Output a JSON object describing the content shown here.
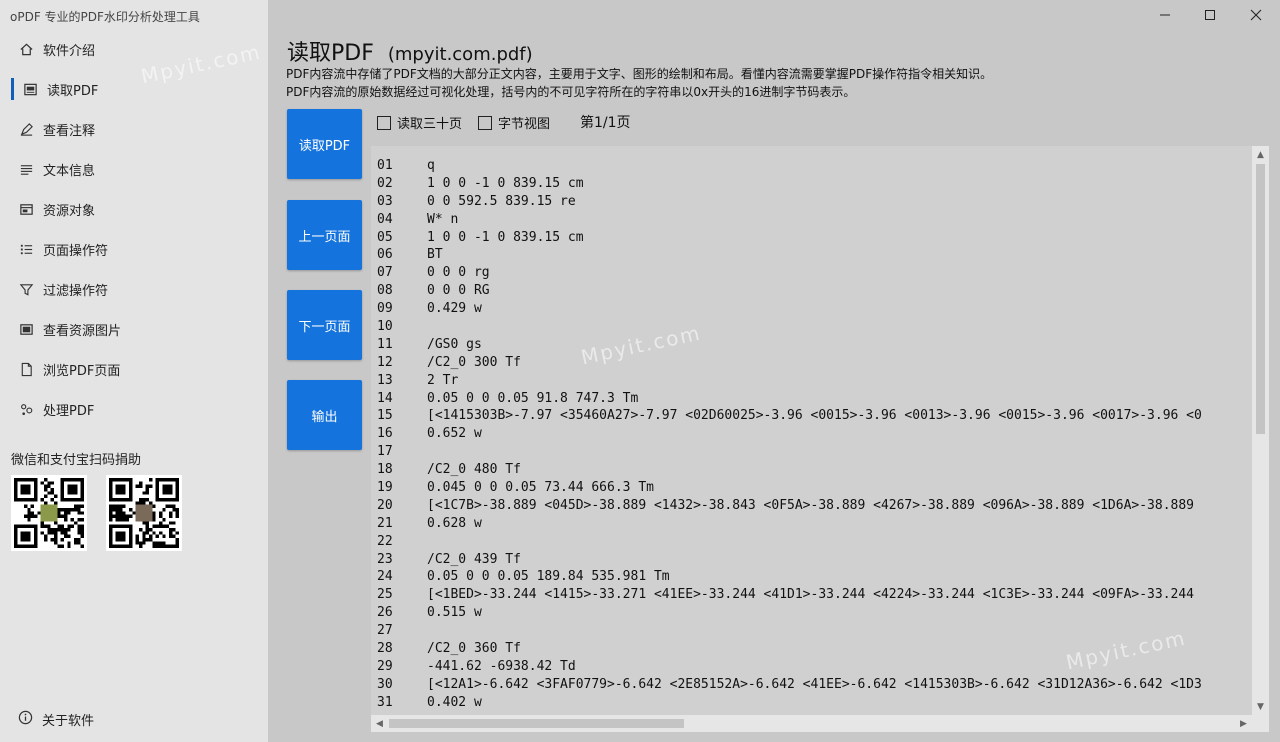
{
  "app": {
    "title": "oPDF 专业的PDF水印分析处理工具"
  },
  "sidebar": {
    "items": [
      {
        "label": "软件介绍",
        "icon": "home-icon"
      },
      {
        "label": "读取PDF",
        "icon": "pdf-icon",
        "active": true
      },
      {
        "label": "查看注释",
        "icon": "annotation-icon"
      },
      {
        "label": "文本信息",
        "icon": "text-lines-icon"
      },
      {
        "label": "资源对象",
        "icon": "resource-icon"
      },
      {
        "label": "页面操作符",
        "icon": "list-icon"
      },
      {
        "label": "过滤操作符",
        "icon": "filter-icon"
      },
      {
        "label": "查看资源图片",
        "icon": "image-icon"
      },
      {
        "label": "浏览PDF页面",
        "icon": "page-icon"
      },
      {
        "label": "处理PDF",
        "icon": "process-icon"
      }
    ],
    "donate_label": "微信和支付宝扫码捐助",
    "about_label": "关于软件"
  },
  "main": {
    "title": "读取PDF",
    "filename": "(mpyit.com.pdf)",
    "desc1": "PDF内容流中存储了PDF文档的大部分正文内容，主要用于文字、图形的绘制和布局。看懂内容流需要掌握PDF操作符指令相关知识。",
    "desc2": "PDF内容流的原始数据经过可视化处理，括号内的不可见字符所在的字符串以0x开头的16进制字节码表示。",
    "buttons": {
      "read": "读取PDF",
      "prev": "上一页面",
      "next": "下一页面",
      "export": "输出"
    },
    "options": {
      "read30": "读取三十页",
      "byteview": "字节视图"
    },
    "page_info": "第1/1页",
    "watermark": "Mpyit.com",
    "lines": [
      {
        "n": "01",
        "t": "q"
      },
      {
        "n": "02",
        "t": "1 0 0 -1 0 839.15 cm"
      },
      {
        "n": "03",
        "t": "0 0 592.5 839.15 re"
      },
      {
        "n": "04",
        "t": "W* n"
      },
      {
        "n": "05",
        "t": "1 0 0 -1 0 839.15 cm"
      },
      {
        "n": "06",
        "t": "BT"
      },
      {
        "n": "07",
        "t": "0 0 0 rg"
      },
      {
        "n": "08",
        "t": "0 0 0 RG"
      },
      {
        "n": "09",
        "t": "0.429 w"
      },
      {
        "n": "10",
        "t": ""
      },
      {
        "n": "11",
        "t": "/GS0 gs"
      },
      {
        "n": "12",
        "t": "/C2_0 300 Tf"
      },
      {
        "n": "13",
        "t": "2 Tr"
      },
      {
        "n": "14",
        "t": "0.05 0 0 0.05 91.8 747.3 Tm"
      },
      {
        "n": "15",
        "t": "[<1415303B>-7.97 <35460A27>-7.97 <02D60025>-3.96 <0015>-3.96 <0013>-3.96 <0015>-3.96 <0017>-3.96 <0"
      },
      {
        "n": "16",
        "t": "0.652 w"
      },
      {
        "n": "17",
        "t": ""
      },
      {
        "n": "18",
        "t": "/C2_0 480 Tf"
      },
      {
        "n": "19",
        "t": "0.045 0 0 0.05 73.44 666.3 Tm"
      },
      {
        "n": "20",
        "t": "[<1C7B>-38.889 <045D>-38.889 <1432>-38.843 <0F5A>-38.889 <4267>-38.889 <096A>-38.889 <1D6A>-38.889"
      },
      {
        "n": "21",
        "t": "0.628 w"
      },
      {
        "n": "22",
        "t": ""
      },
      {
        "n": "23",
        "t": "/C2_0 439 Tf"
      },
      {
        "n": "24",
        "t": "0.05 0 0 0.05 189.84 535.981 Tm"
      },
      {
        "n": "25",
        "t": "[<1BED>-33.244 <1415>-33.271 <41EE>-33.244 <41D1>-33.244 <4224>-33.244 <1C3E>-33.244 <09FA>-33.244"
      },
      {
        "n": "26",
        "t": "0.515 w"
      },
      {
        "n": "27",
        "t": ""
      },
      {
        "n": "28",
        "t": "/C2_0 360 Tf"
      },
      {
        "n": "29",
        "t": "-441.62 -6938.42 Td"
      },
      {
        "n": "30",
        "t": "[<12A1>-6.642 <3FAF0779>-6.642 <2E85152A>-6.642 <41EE>-6.642 <1415303B>-6.642 <31D12A36>-6.642 <1D3"
      },
      {
        "n": "31",
        "t": "0.402 w"
      }
    ]
  }
}
